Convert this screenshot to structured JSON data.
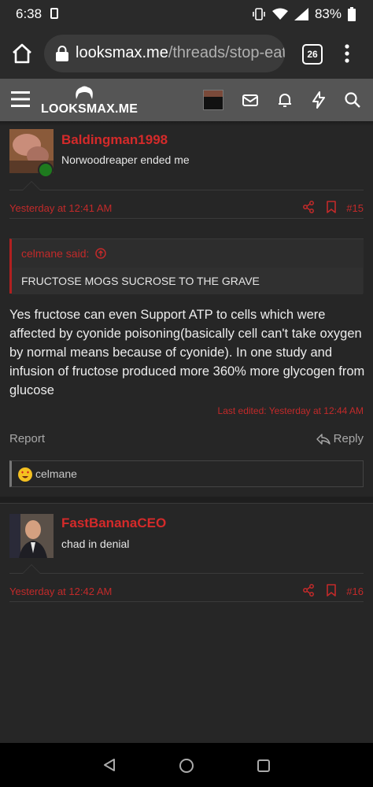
{
  "status": {
    "time": "6:38",
    "battery": "83%"
  },
  "browser": {
    "domain": "looksmax.me",
    "path": "/threads/stop-eat",
    "tab_count": "26"
  },
  "site": {
    "logo_text": "LOOKSMAX.ME"
  },
  "posts": [
    {
      "username": "Baldingman1998",
      "user_title": "Norwoodreaper ended me",
      "date": "Yesterday at 12:41 AM",
      "number": "#15",
      "quote": {
        "author": "celmane said:",
        "text": "FRUCTOSE MOGS SUCROSE TO THE GRAVE"
      },
      "body": "Yes fructose can even Support ATP to cells which were affected by cyonide poisoning(basically cell can't take oxygen by normal means because of cyonide). In one study and infusion of fructose produced more 360% more glycogen from glucose",
      "last_edited": "Last edited: Yesterday at 12:44 AM",
      "report_label": "Report",
      "reply_label": "Reply",
      "reaction_user": "celmane"
    },
    {
      "username": "FastBananaCEO",
      "user_title": "chad in denial",
      "date": "Yesterday at 12:42 AM",
      "number": "#16"
    }
  ],
  "colors": {
    "accent": "#d42a2a",
    "background": "#262626",
    "header": "#555555"
  }
}
